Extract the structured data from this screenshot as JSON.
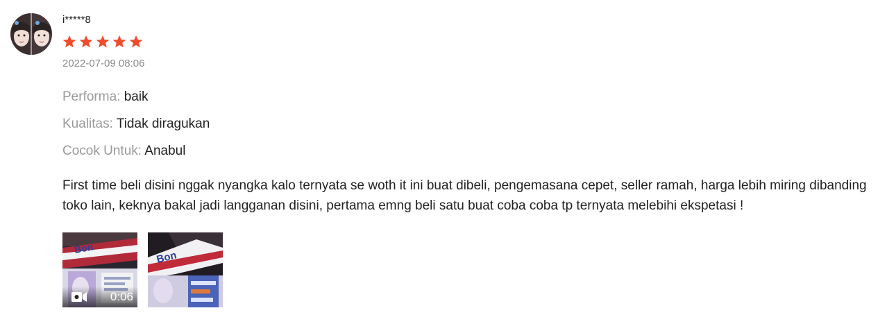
{
  "review": {
    "username": "i*****8",
    "rating": 5,
    "rating_max": 5,
    "timestamp": "2022-07-09 08:06",
    "attributes": [
      {
        "label": "Performa:",
        "value": "baik"
      },
      {
        "label": "Kualitas:",
        "value": "Tidak diragukan"
      },
      {
        "label": "Cocok Untuk:",
        "value": "Anabul"
      }
    ],
    "comment": "First time beli disini nggak nyangka kalo ternyata se woth it ini buat dibeli, pengemasana cepet, seller ramah, harga lebih miring dibanding toko lain, keknya bakal jadi langganan disini, pertama emng beli satu buat coba coba tp ternyata melebihi ekspetasi !",
    "media": [
      {
        "type": "video",
        "duration": "0:06",
        "icon": "video-camera-icon"
      },
      {
        "type": "image"
      }
    ]
  },
  "colors": {
    "star": "#ee4d2d",
    "label_gray": "#9a9a9a",
    "text": "#222222"
  }
}
